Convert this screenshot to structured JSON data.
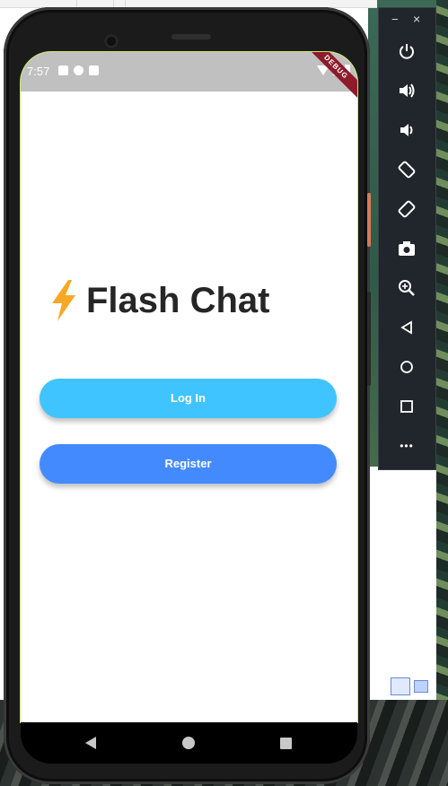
{
  "status_bar": {
    "time": "7:57",
    "debug_banner": "DEBUG"
  },
  "app": {
    "title": "Flash Chat",
    "login_label": "Log In",
    "register_label": "Register",
    "colors": {
      "login": "#40c4ff",
      "register": "#448aff",
      "bolt": "#f9a825"
    }
  },
  "nav": {
    "back": "nav-back",
    "home": "nav-home",
    "recents": "nav-recents"
  },
  "emulator_toolbar": {
    "minimize": "−",
    "close": "×",
    "more": "•••",
    "items": [
      "power",
      "volume-up",
      "volume-down",
      "rotate-left",
      "rotate-right",
      "screenshot",
      "zoom",
      "back",
      "home",
      "overview",
      "more"
    ]
  }
}
